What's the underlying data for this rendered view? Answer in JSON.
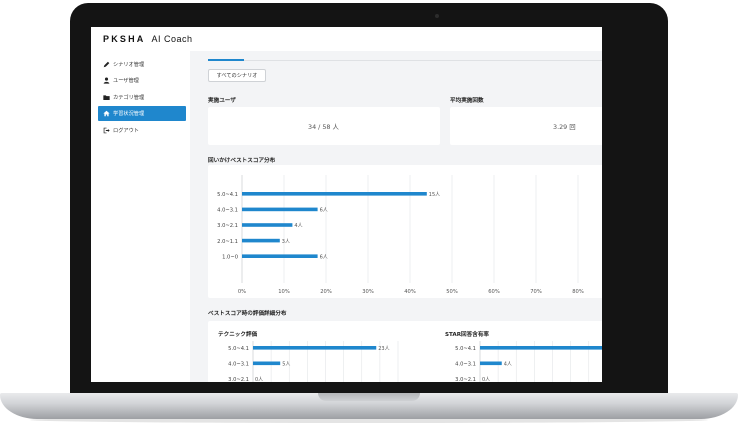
{
  "header": {
    "brand": "PKSHA",
    "product": "AI Coach"
  },
  "sidebar": {
    "items": [
      {
        "label": "シナリオ管理",
        "icon": "pencil-icon"
      },
      {
        "label": "ユーザ管理",
        "icon": "user-icon"
      },
      {
        "label": "カテゴリ管理",
        "icon": "folder-icon"
      },
      {
        "label": "学習状況管理",
        "icon": "home-icon",
        "active": true
      },
      {
        "label": "ログアウト",
        "icon": "logout-icon"
      }
    ]
  },
  "filter": {
    "label": "すべてのシナリオ"
  },
  "stats": {
    "users_title": "実施ユーザ",
    "users_value": "34 / 58 人",
    "avg_title": "平均実施回数",
    "avg_value": "3.29 回"
  },
  "colors": {
    "accent": "#1f87cd",
    "bar": "#1f87cd"
  },
  "best_score": {
    "title": "回いかけベストスコア分布",
    "chart_data": {
      "type": "bar",
      "orientation": "horizontal",
      "categories": [
        "5.0~4.1",
        "4.0~3.1",
        "3.0~2.1",
        "2.0~1.1",
        "1.0~0"
      ],
      "values": [
        15,
        6,
        4,
        3,
        6
      ],
      "value_labels": [
        "15人",
        "6人",
        "4人",
        "3人",
        "6人"
      ],
      "percent_of_total": [
        44,
        18,
        12,
        9,
        18
      ],
      "xlim": [
        0,
        80
      ],
      "x_ticks": [
        "0%",
        "10%",
        "20%",
        "30%",
        "40%",
        "50%",
        "60%",
        "70%",
        "80%"
      ],
      "grid": true
    }
  },
  "detail": {
    "title": "ベストスコア時の評価詳細分布",
    "charts": [
      {
        "title": "テクニック評価",
        "chart_data": {
          "type": "bar",
          "orientation": "horizontal",
          "categories": [
            "5.0~4.1",
            "4.0~3.1",
            "3.0~2.1"
          ],
          "values": [
            23,
            5,
            0
          ],
          "value_labels": [
            "23人",
            "5人",
            "0人"
          ],
          "percent_of_total": [
            68,
            15,
            0
          ],
          "xlim": [
            0,
            80
          ],
          "grid": true
        }
      },
      {
        "title": "STAR回答含有率",
        "chart_data": {
          "type": "bar",
          "orientation": "horizontal",
          "categories": [
            "5.0~4.1",
            "4.0~3.1",
            "3.0~2.1"
          ],
          "values": [
            null,
            4,
            0
          ],
          "value_labels": [
            "",
            "4人",
            "0人"
          ],
          "percent_of_total": [
            null,
            12,
            0
          ],
          "xlim": [
            0,
            80
          ],
          "grid": true
        }
      }
    ]
  }
}
